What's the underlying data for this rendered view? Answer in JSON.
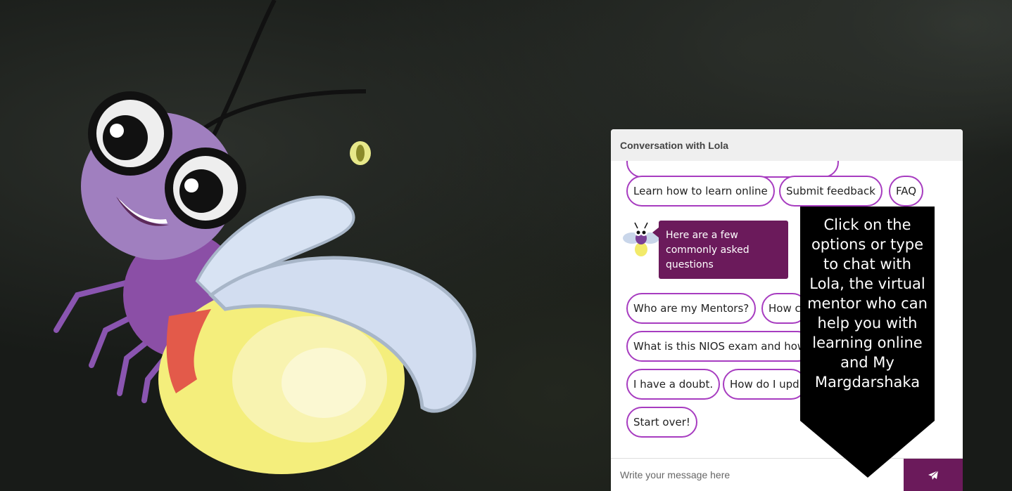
{
  "chat": {
    "title": "Conversation with Lola",
    "top_options": [
      "Learn how to learn online",
      "Submit feedback",
      "FAQ"
    ],
    "bot_message": "Here are a few commonly asked questions",
    "faq_options": [
      "Who are my Mentors?",
      "How c",
      "What is this NIOS exam and how",
      "I have a doubt.",
      "How do I upd",
      "Start over!"
    ],
    "input_placeholder": "Write your message here",
    "send_icon": "paper-plane-icon"
  },
  "tooltip": {
    "text": "Click on the options or type to chat with Lola, the virtual mentor who can help you with learning online and My Margdarshaka"
  },
  "colors": {
    "accent": "#6b1a5b",
    "chip_border": "#a73cc0",
    "header_bg": "#efefef"
  }
}
